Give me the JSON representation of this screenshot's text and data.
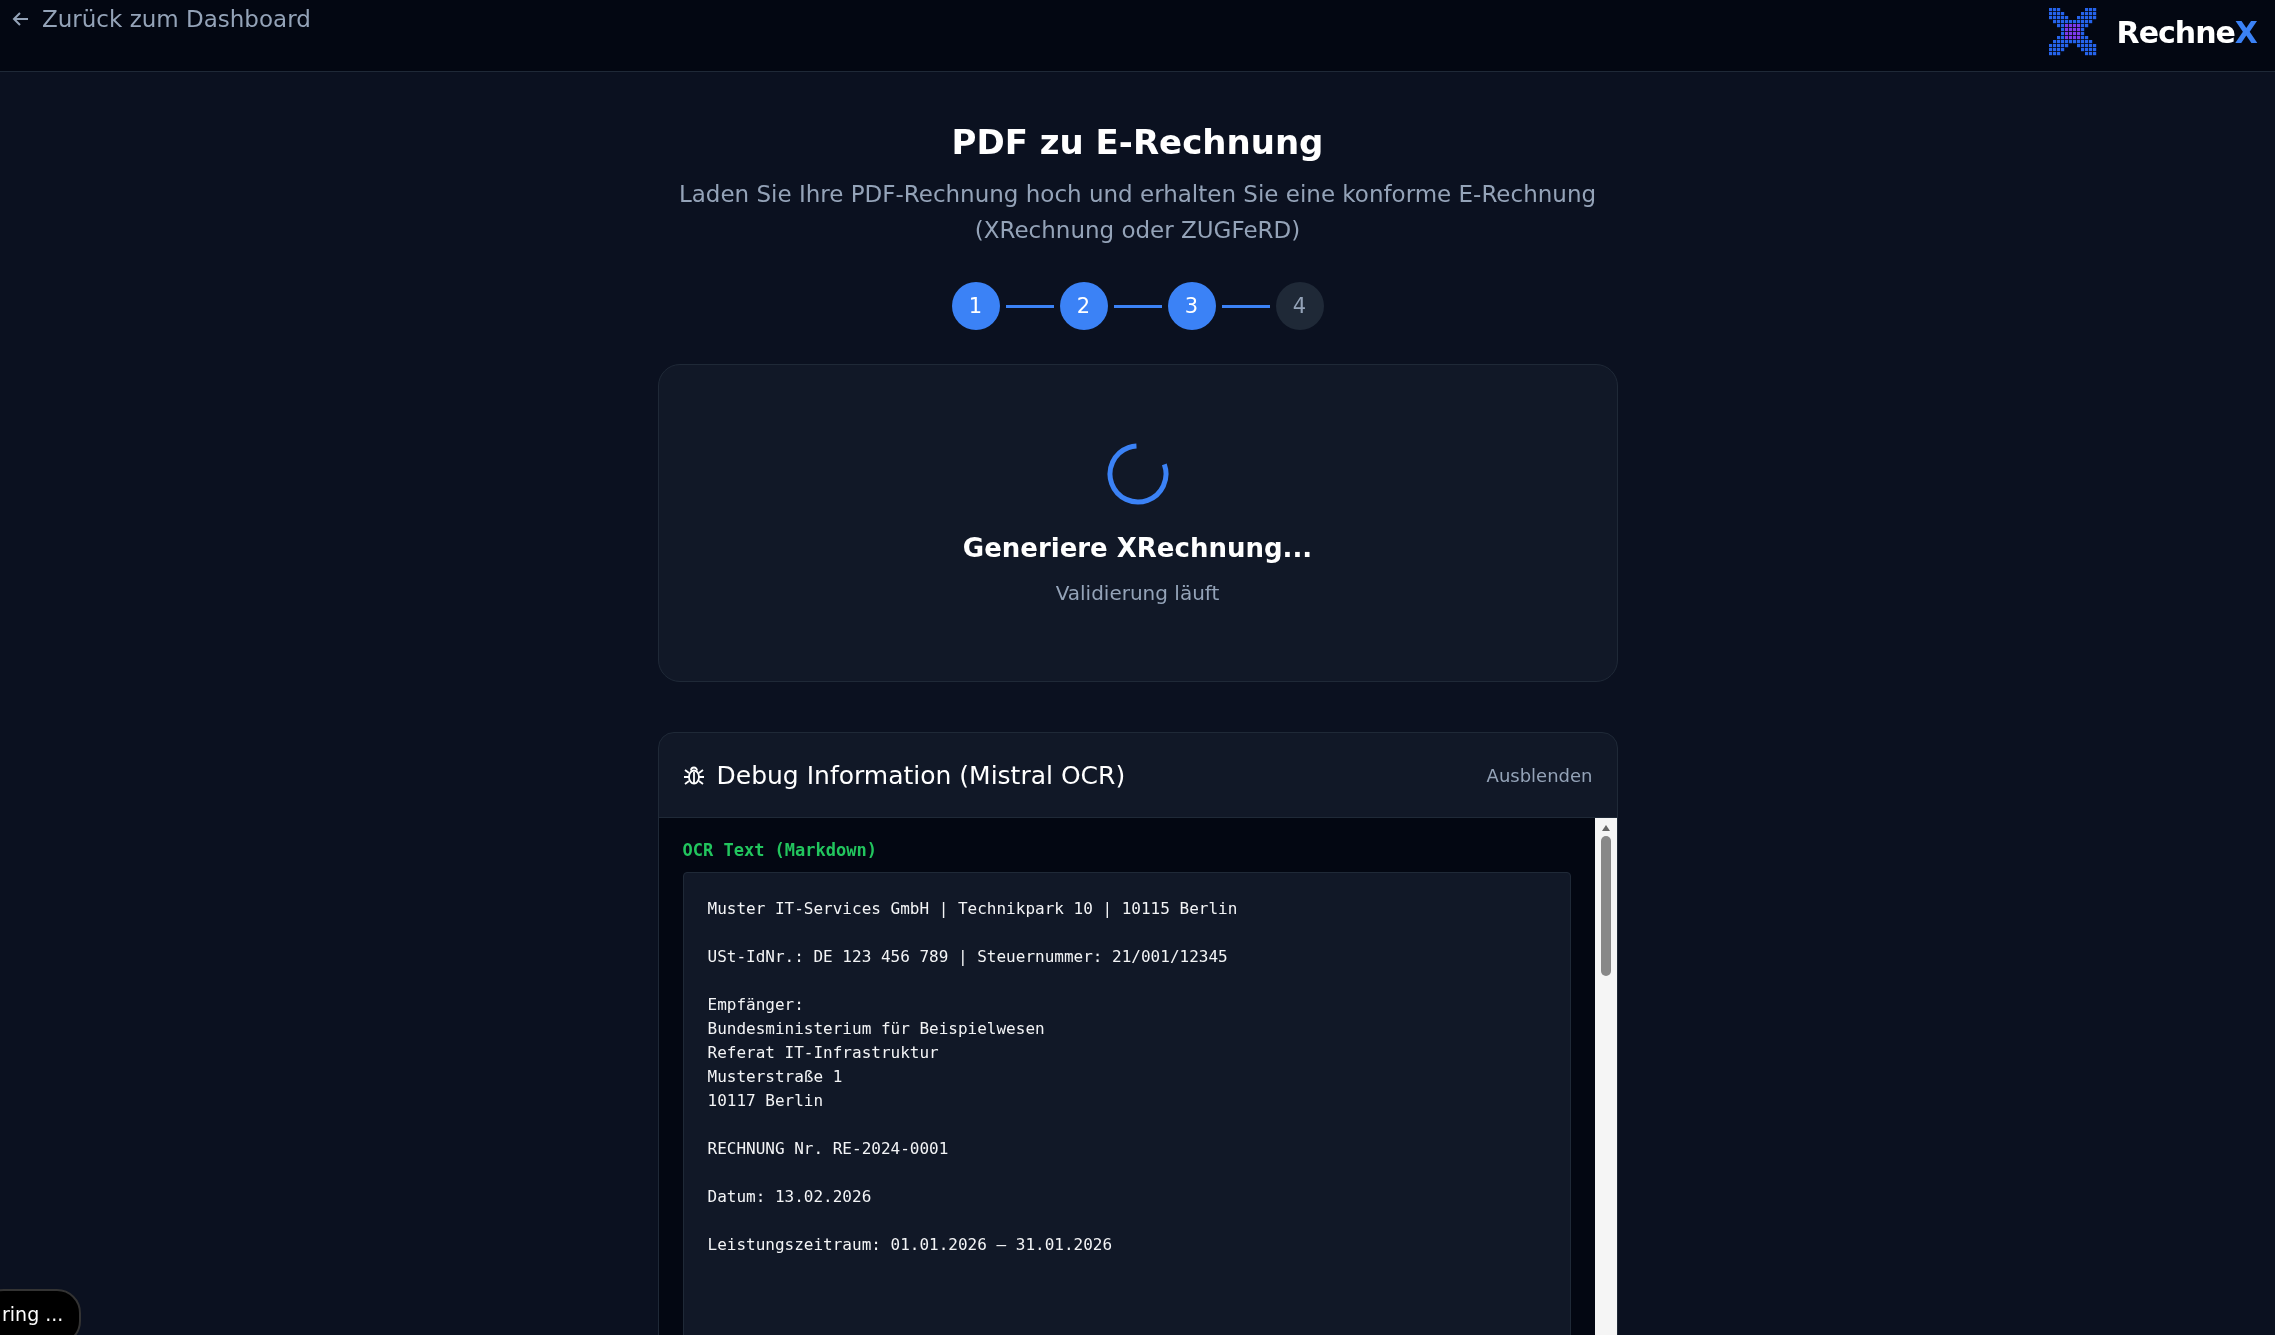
{
  "header": {
    "back_link": "Zurück zum Dashboard",
    "logo": {
      "text": "Rechne",
      "accent": "X"
    }
  },
  "title": "PDF zu E-Rechnung",
  "subtitle": "Laden Sie Ihre PDF-Rechnung hoch und erhalten Sie eine konforme E-Rechnung (XRechnung oder ZUGFeRD)",
  "steps": [
    {
      "label": "1",
      "active": true
    },
    {
      "label": "2",
      "active": true
    },
    {
      "label": "3",
      "active": true
    },
    {
      "label": "4",
      "active": false
    }
  ],
  "progress": {
    "title": "Generiere XRechnung...",
    "status": "Validierung läuft"
  },
  "debug": {
    "title": "Debug Information (Mistral OCR)",
    "toggle": "Ausblenden",
    "section_label": "OCR Text (Markdown)",
    "ocr_blocks": [
      [
        "Muster IT-Services GmbH | Technikpark 10 | 10115 Berlin"
      ],
      [
        "USt-IdNr.: DE 123 456 789 | Steuernummer: 21/001/12345"
      ],
      [
        "Empfänger:",
        "Bundesministerium für Beispielwesen",
        "Referat IT-Infrastruktur",
        "Musterstraße 1",
        "10117 Berlin"
      ],
      [
        "RECHNUNG Nr. RE-2024-0001"
      ],
      [
        "Datum: 13.02.2026"
      ],
      [
        "Leistungszeitraum: 01.01.2026 – 31.01.2026"
      ]
    ]
  },
  "toast": "ring ..."
}
